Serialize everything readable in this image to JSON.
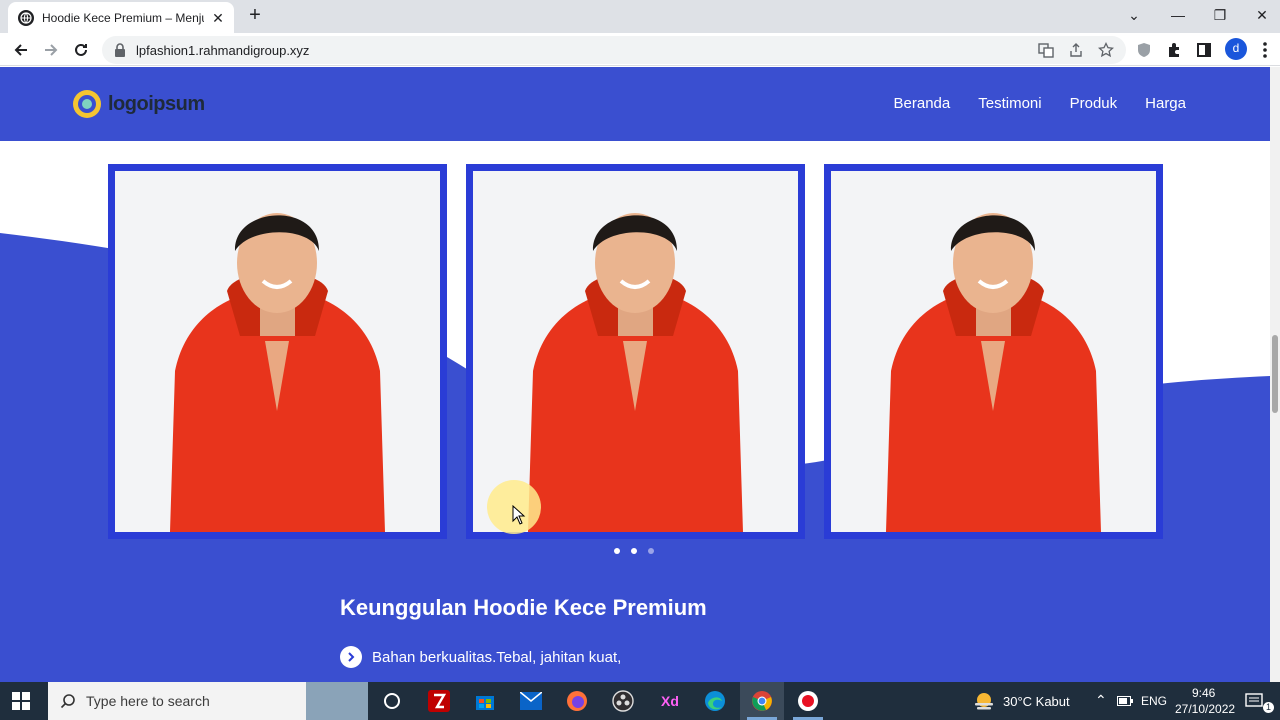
{
  "browser": {
    "tab_title": "Hoodie Kece Premium – Menjual",
    "url": "lpfashion1.rahmandigroup.xyz",
    "new_tab": "+",
    "profile_initial": "d"
  },
  "site": {
    "logo_text": "logoipsum",
    "nav": [
      "Beranda",
      "Testimoni",
      "Produk",
      "Harga"
    ],
    "colors": {
      "primary": "#3a4fd0",
      "card_border": "#2a3cd6"
    }
  },
  "gallery": {
    "cards": [
      {
        "alt": "man-in-red-hoodie"
      },
      {
        "alt": "man-in-red-hoodie"
      },
      {
        "alt": "man-in-red-hoodie"
      }
    ],
    "dots_total": 3,
    "dot_active": 2
  },
  "features": {
    "title": "Keunggulan Hoodie Kece Premium",
    "items": [
      "Bahan berkualitas.Tebal, jahitan kuat,"
    ]
  },
  "taskbar": {
    "search_placeholder": "Type here to search",
    "weather": "30°C  Kabut",
    "language": "ENG",
    "time": "9:46",
    "date": "27/10/2022",
    "notification_count": "1",
    "xd_label": "Xd"
  }
}
